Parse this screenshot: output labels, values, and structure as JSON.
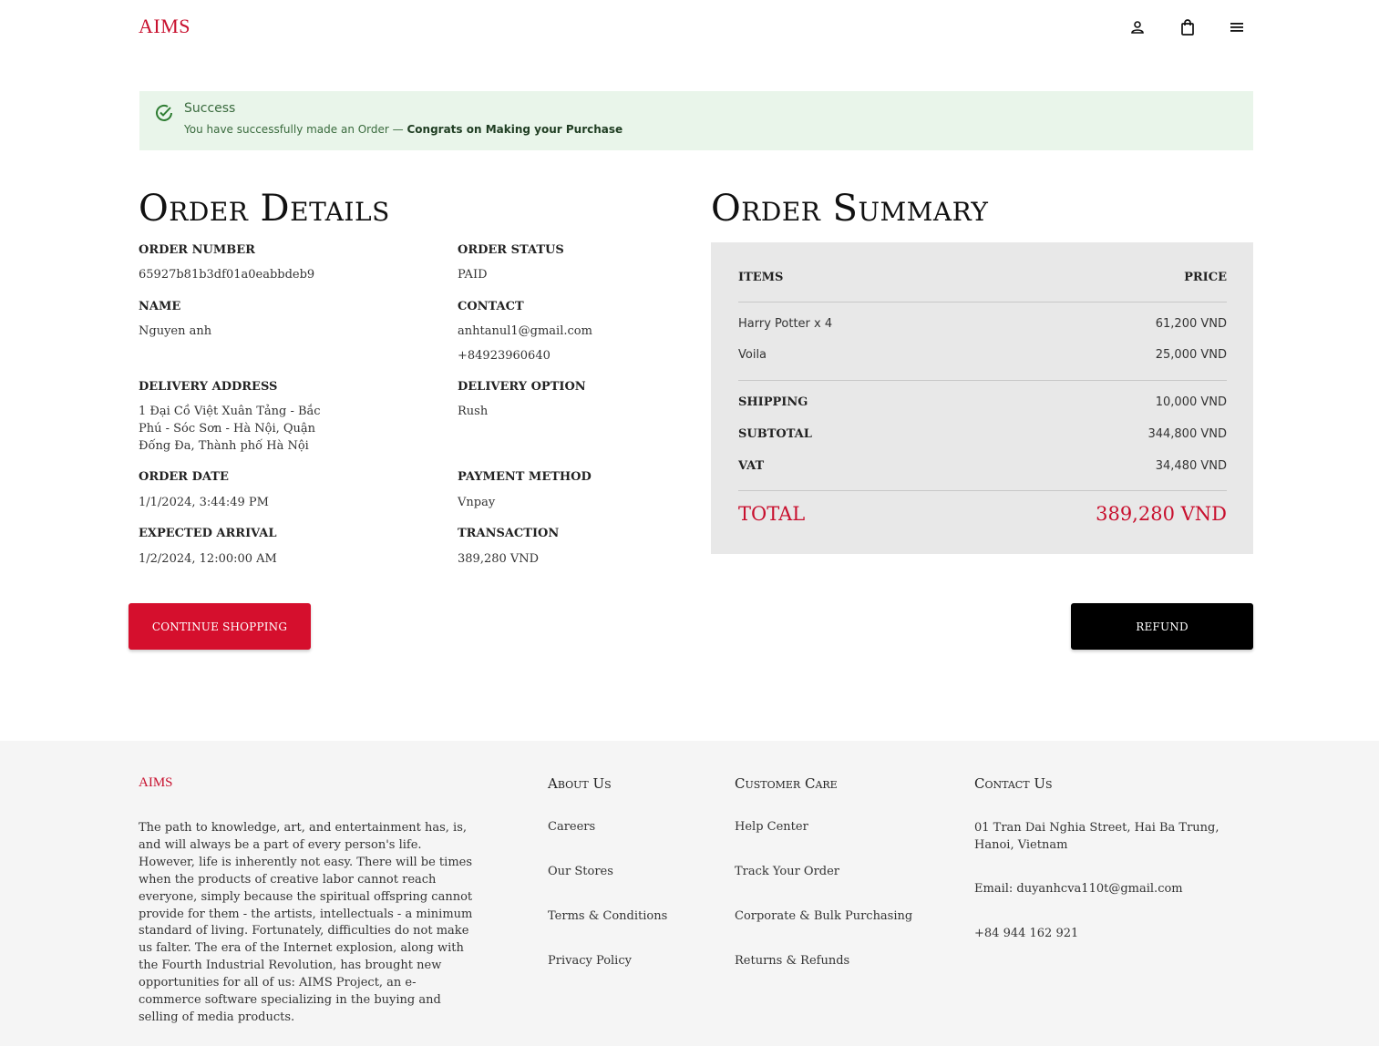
{
  "brand": {
    "logo": "AIMS",
    "color": "#c8102e"
  },
  "header": {
    "icons": [
      "user-icon",
      "shopping-bag-icon",
      "menu-icon"
    ]
  },
  "alert": {
    "title": "Success",
    "message": "You have successfully made an Order — ",
    "emphasis": "Congrats on Making your Purchase",
    "color": "#e9f5ea"
  },
  "order_details": {
    "title": "Order Details",
    "fields": {
      "order_number": {
        "label": "ORDER NUMBER",
        "value": "65927b81b3df01a0eabbdeb9"
      },
      "order_status": {
        "label": "ORDER STATUS",
        "value": "PAID"
      },
      "name": {
        "label": "NAME",
        "value": "Nguyen anh"
      },
      "contact": {
        "label": "CONTACT",
        "email": "anhtanul1@gmail.com",
        "phone": "+84923960640"
      },
      "delivery_address": {
        "label": "DELIVERY ADDRESS",
        "lines": [
          "1 Đại Cồ Việt Xuân Tảng - Bắc",
          "Phú - Sóc Sơn - Hà Nội, Quận",
          "Đống Đa, Thành phố Hà Nội"
        ]
      },
      "delivery_option": {
        "label": "DELIVERY OPTION",
        "value": "Rush"
      },
      "order_date": {
        "label": "ORDER DATE",
        "value": "1/1/2024, 3:44:49 PM"
      },
      "payment_method": {
        "label": "PAYMENT METHOD",
        "value": "Vnpay"
      },
      "expected_arrival": {
        "label": "EXPECTED ARRIVAL",
        "value": "1/2/2024, 12:00:00 AM"
      },
      "transaction": {
        "label": "TRANSACTION",
        "value": "389,280 VND"
      }
    }
  },
  "order_summary": {
    "title": "Order Summary",
    "items_label": "ITEMS",
    "price_label": "PRICE",
    "items": [
      {
        "name": "Harry Potter x 4",
        "price": "61,200 VND"
      },
      {
        "name": "Voila",
        "price": "25,000 VND"
      }
    ],
    "shipping": {
      "label": "SHIPPING",
      "value": "10,000 VND"
    },
    "subtotal": {
      "label": "SUBTOTAL",
      "value": "344,800 VND"
    },
    "vat": {
      "label": "VAT",
      "value": "34,480 VND"
    },
    "total": {
      "label": "TOTAL",
      "value": "389,280 VND"
    }
  },
  "buttons": {
    "continue_shopping": "CONTINUE SHOPPING",
    "refund": "REFUND"
  },
  "footer": {
    "logo": "AIMS",
    "description": "The path to knowledge, art, and entertainment has, is, and will always be a part of every person's life. However, life is inherently not easy. There will be times when the products of creative labor cannot reach everyone, simply because the spiritual offspring cannot provide for them - the artists, intellectuals - a minimum standard of living. Fortunately, difficulties do not make us falter. The era of the Internet explosion, along with the Fourth Industrial Revolution, has brought new opportunities for all of us: AIMS Project, an e-commerce software specializing in the buying and selling of media products.",
    "about": {
      "title": "About Us",
      "links": [
        "Careers",
        "Our Stores",
        "Terms & Conditions",
        "Privacy Policy"
      ]
    },
    "care": {
      "title": "Customer Care",
      "links": [
        "Help Center",
        "Track Your Order",
        "Corporate & Bulk Purchasing",
        "Returns & Refunds"
      ]
    },
    "contact": {
      "title": "Contact Us",
      "address": "01 Tran Dai Nghia Street, Hai Ba Trung, Hanoi, Vietnam",
      "email": "Email: duyanhcva110t@gmail.com",
      "phone": "+84 944 162 921"
    }
  }
}
